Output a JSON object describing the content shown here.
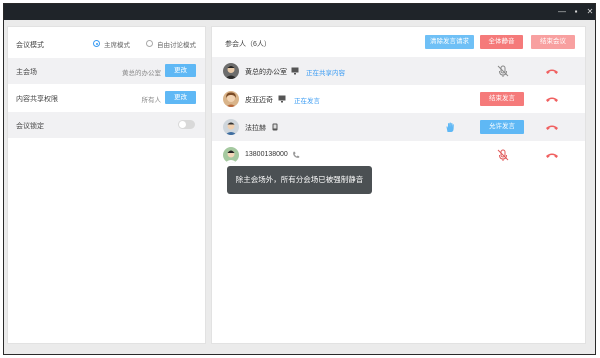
{
  "window_controls": {
    "minimize": "—",
    "maximize": "▪",
    "close": "✕"
  },
  "left_panel": {
    "meeting_mode": {
      "label": "会议模式",
      "options": [
        {
          "label": "主席模式",
          "selected": true
        },
        {
          "label": "自由讨论模式",
          "selected": false
        }
      ]
    },
    "main_venue": {
      "label": "主会场",
      "value": "黄总的办公室",
      "button": "更改"
    },
    "share_permission": {
      "label": "内容共享权限",
      "value": "所有人",
      "button": "更改"
    },
    "meeting_lock": {
      "label": "会议锁定",
      "enabled": false
    }
  },
  "right_panel": {
    "title": "参会人（6人）",
    "buttons": {
      "clear_requests": "清除发言请求",
      "mute_all": "全体静音",
      "end_meeting": "结束会议"
    },
    "participants": [
      {
        "name": "黄总的办公室",
        "device": "desktop-icon",
        "status": "正在共享内容",
        "action": "",
        "mic": "mic-muted-icon",
        "mic_color": "#888888"
      },
      {
        "name": "皮亚迈奇",
        "device": "desktop-icon",
        "status": "正在发言",
        "action": "结束发言",
        "mic": "",
        "mic_color": ""
      },
      {
        "name": "法拉赫",
        "device": "phone-icon",
        "status": "",
        "action": "允许发言",
        "mic": "hand-raise-icon",
        "mic_color": "#5fb8f5"
      },
      {
        "name": "13800138000",
        "device": "phone-handset-icon",
        "status": "",
        "action": "",
        "mic": "mic-muted-icon",
        "mic_color": "#e05a5a"
      }
    ]
  },
  "toast": {
    "text": "除主会场外，所有分会场已被强制静音"
  },
  "colors": {
    "accent_blue": "#5fb8f5",
    "danger_red": "#f57a7a",
    "hangup_red": "#f06060"
  }
}
